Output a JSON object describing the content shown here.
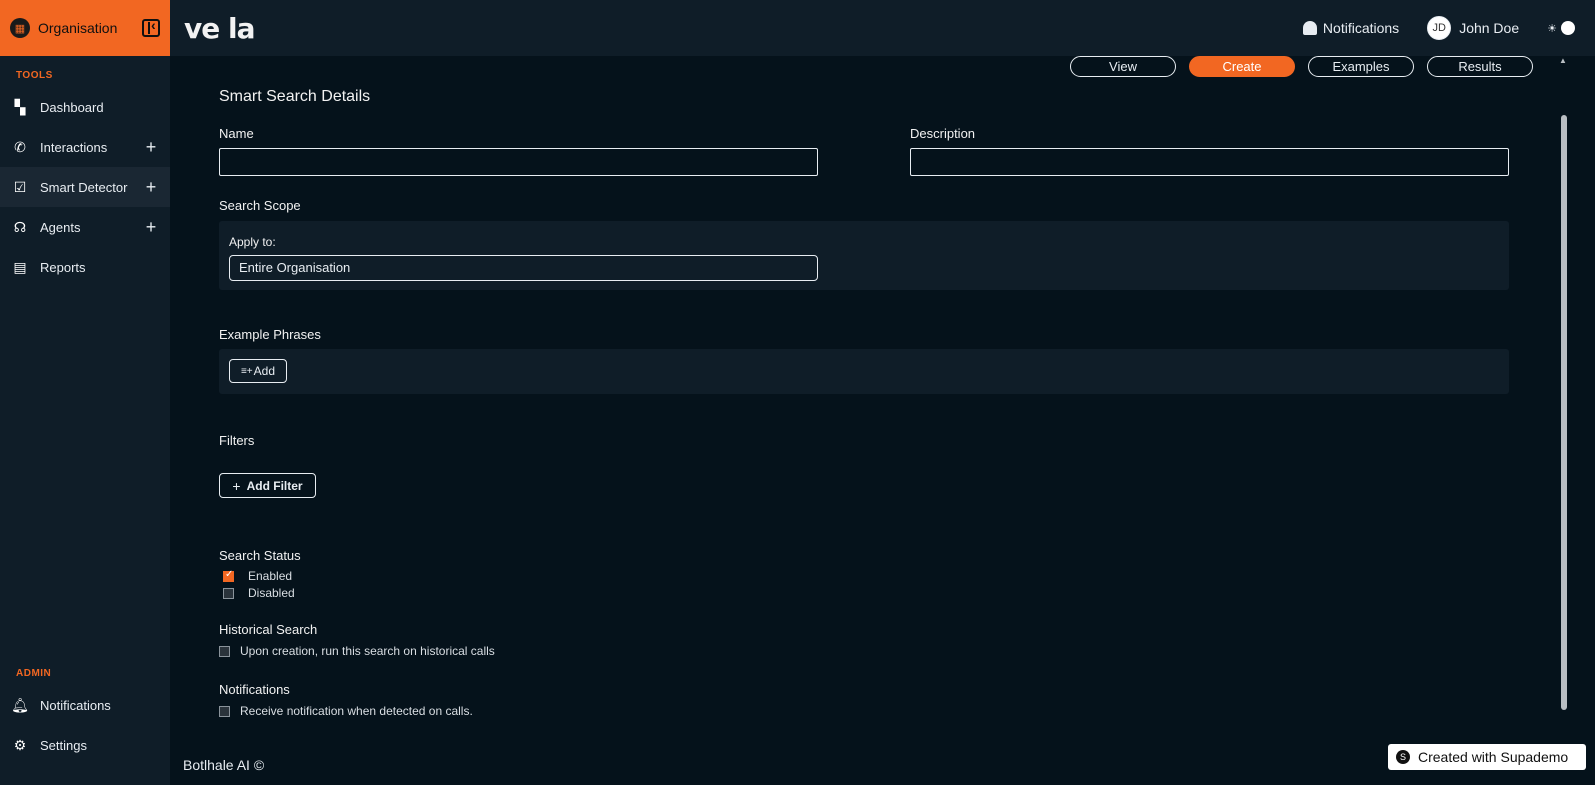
{
  "sidebar": {
    "org_label": "Organisation",
    "tools_label": "TOOLS",
    "admin_label": "ADMIN",
    "items": [
      {
        "label": "Dashboard"
      },
      {
        "label": "Interactions"
      },
      {
        "label": "Smart Detector"
      },
      {
        "label": "Agents"
      },
      {
        "label": "Reports"
      }
    ],
    "admin_items": [
      {
        "label": "Notifications"
      },
      {
        "label": "Settings"
      }
    ]
  },
  "header": {
    "logo": "ve la",
    "notifications_label": "Notifications",
    "user_initials": "JD",
    "user_name": "John Doe"
  },
  "tabs": [
    {
      "label": "View"
    },
    {
      "label": "Create"
    },
    {
      "label": "Examples"
    },
    {
      "label": "Results"
    }
  ],
  "form": {
    "title": "Smart Search Details",
    "name_label": "Name",
    "name_value": "",
    "description_label": "Description",
    "description_value": "",
    "scope_label": "Search Scope",
    "apply_to_label": "Apply to:",
    "apply_to_value": "Entire Organisation",
    "phrases_label": "Example Phrases",
    "add_label": "Add",
    "filters_label": "Filters",
    "add_filter_label": "Add Filter",
    "status_label": "Search Status",
    "status_enabled": "Enabled",
    "status_disabled": "Disabled",
    "historical_label": "Historical Search",
    "historical_option": "Upon creation, run this search on historical calls",
    "notifications_label": "Notifications",
    "notifications_option": "Receive notification when detected on calls."
  },
  "footer": {
    "text": "Botlhale AI ©",
    "supademo": "Created with Supademo"
  },
  "colors": {
    "accent": "#f26722",
    "background": "#05121b",
    "panel": "#0f1d28"
  }
}
